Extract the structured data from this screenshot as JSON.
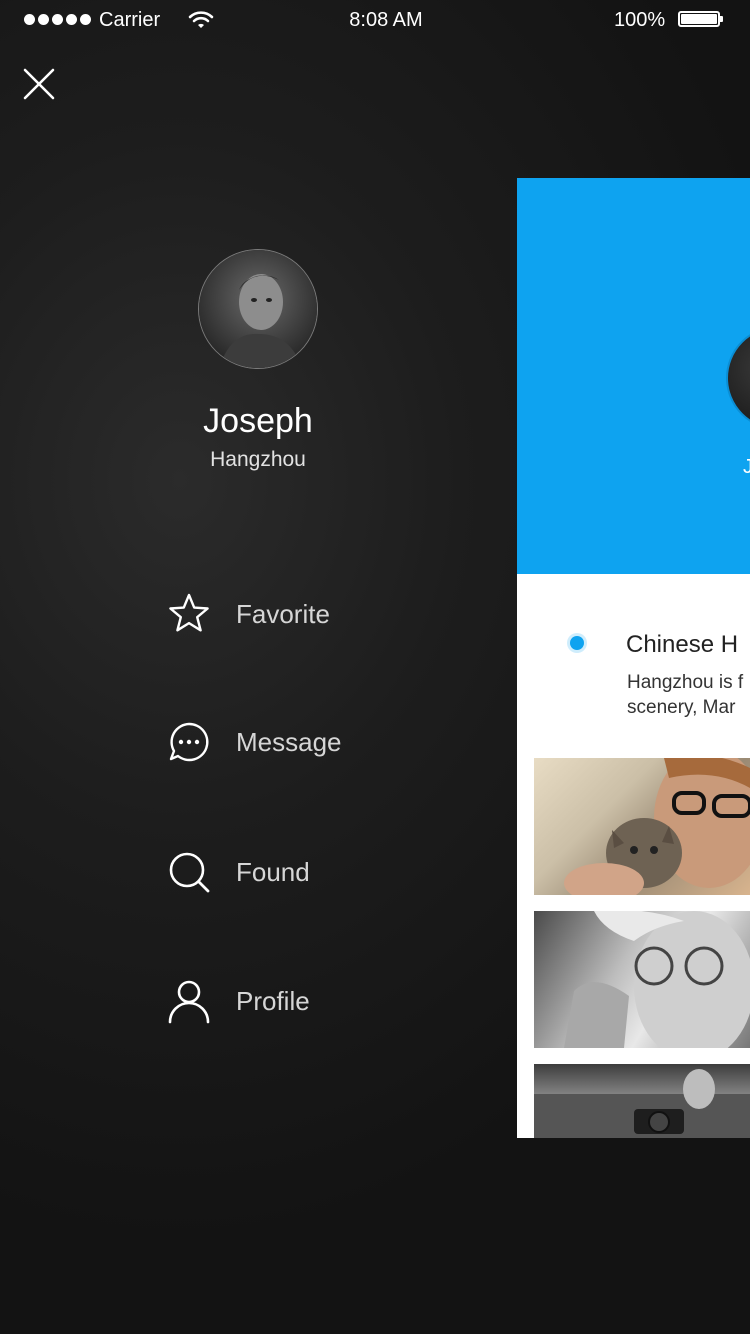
{
  "status_bar": {
    "carrier": "Carrier",
    "time": "8:08 AM",
    "battery": "100%",
    "signal_bars": 5
  },
  "drawer": {
    "user": {
      "name": "Joseph",
      "city": "Hangzhou"
    },
    "menu": [
      {
        "label": "Favorite",
        "icon": "star-icon"
      },
      {
        "label": "Message",
        "icon": "chat-bubble-icon"
      },
      {
        "label": "Found",
        "icon": "search-icon"
      },
      {
        "label": "Profile",
        "icon": "user-icon"
      }
    ]
  },
  "preview_card": {
    "initial": "J",
    "title": "Chinese H",
    "text_line1": "Hangzhou is f",
    "text_line2": "scenery,  Mar"
  },
  "colors": {
    "accent": "#0ea3f0",
    "background": "#1a1a1a",
    "text": "#ffffff"
  }
}
